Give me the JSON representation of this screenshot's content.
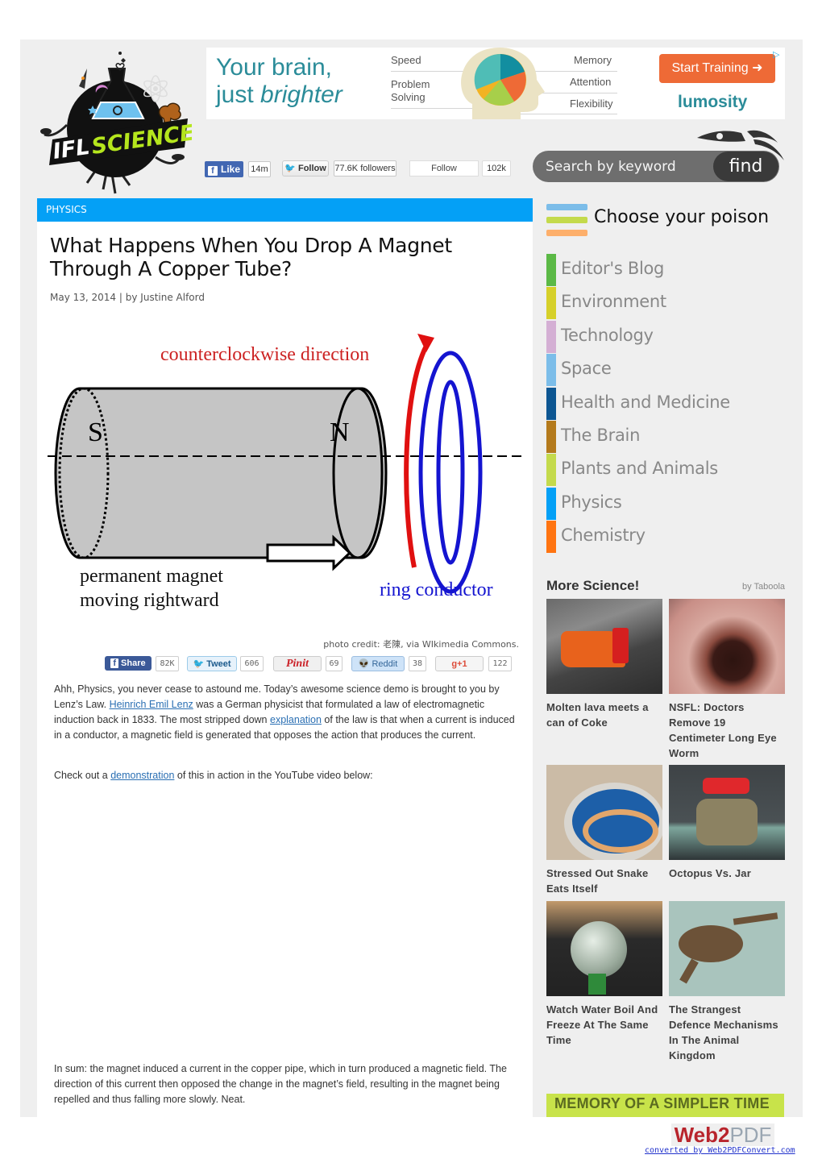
{
  "site": {
    "name": "IFLSCIENCE!"
  },
  "ad_banner": {
    "headline_line1": "Your brain,",
    "headline_line2_plain": "just ",
    "headline_line2_italic": "brighter",
    "labels_left": [
      "Speed",
      "Problem",
      "Solving"
    ],
    "labels_right": [
      "Memory",
      "Attention",
      "Flexibility"
    ],
    "cta": "Start Training ➜",
    "brand": "lumosity",
    "adchoices_icon": "adchoices-icon"
  },
  "social": {
    "facebook": {
      "label": "Like",
      "count": "14m"
    },
    "twitter": {
      "label": "Follow",
      "count": "77.6K followers"
    },
    "google": {
      "label": "Follow",
      "count": "102k"
    }
  },
  "search": {
    "placeholder": "Search by keyword",
    "button": "find"
  },
  "article": {
    "category": "PHYSICS",
    "title": "What Happens When You Drop A Magnet Through A Copper Tube?",
    "date": "May 13, 2014",
    "separator": "|",
    "byline": "by Justine Alford",
    "figure": {
      "labels": {
        "top": "counterclockwise direction",
        "south": "S",
        "north": "N",
        "magnet_line1": "permanent magnet",
        "magnet_line2": "moving rightward",
        "ring": "ring conductor"
      }
    },
    "photo_credit": "photo credit: 老陳, via WIkimedia Commons.",
    "share_buttons": [
      {
        "name": "facebook",
        "label": "Share",
        "count": "82K",
        "color": "#3b5998"
      },
      {
        "name": "twitter",
        "label": "Tweet",
        "count": "606",
        "color": "#1b95e0"
      },
      {
        "name": "pinterest",
        "label": "Pinit",
        "count": "69",
        "color": "#cb2027"
      },
      {
        "name": "reddit",
        "label": "Reddit",
        "count": "38",
        "color": "#cee3f8"
      },
      {
        "name": "googleplus",
        "label": "g+1",
        "count": "122",
        "color": "#dd4b39"
      }
    ],
    "paragraph1": {
      "t1": "Ahh, Physics, you never cease to astound me. Today’s awesome science demo is brought to you by Lenz’s Law. ",
      "link1": "Heinrich Emil Lenz",
      "t2": " was a German physicist that formulated a law of electromagnetic induction back in 1833. The most stripped down ",
      "link2": "explanation",
      "t3": " of the law is that when a current is induced in a conductor, a magnetic field is generated that opposes the action that produces the current."
    },
    "paragraph2": {
      "t1": "Check out a ",
      "link": "demonstration",
      "t2": " of this in action in the YouTube video below:"
    },
    "paragraph3": "In sum: the magnet induced a current in the copper pipe, which in turn produced a magnetic field. The direction of this current then opposed the change in the magnet’s field, resulting in the magnet being repelled and thus falling more slowly. Neat."
  },
  "sidebar": {
    "poison_title": "Choose your poison",
    "categories": [
      {
        "label": "Editor's Blog",
        "color": "#5bb946"
      },
      {
        "label": "Environment",
        "color": "#d6d02a"
      },
      {
        "label": "Technology",
        "color": "#d4afd4"
      },
      {
        "label": "Space",
        "color": "#7cbde9"
      },
      {
        "label": "Health and Medicine",
        "color": "#0d5692"
      },
      {
        "label": "The Brain",
        "color": "#b47a1c"
      },
      {
        "label": "Plants and Animals",
        "color": "#c4da4c"
      },
      {
        "label": "Physics",
        "color": "#04a0f6"
      },
      {
        "label": "Chemistry",
        "color": "#ff7411"
      }
    ],
    "more_title": "More Science!",
    "more_by": "by Taboola",
    "tiles": [
      {
        "caption": "Molten lava meets a can of Coke"
      },
      {
        "caption": "NSFL: Doctors Remove 19 Centimeter Long Eye Worm"
      },
      {
        "caption": "Stressed Out Snake Eats Itself"
      },
      {
        "caption": "Octopus Vs. Jar"
      },
      {
        "caption": "Watch Water Boil And Freeze At The Same Time"
      },
      {
        "caption": "The Strangest Defence Mechanisms In The Animal Kingdom"
      }
    ],
    "bottom_ad": "MEMORY OF A SIMPLER TIME"
  },
  "footer": {
    "logo_a": "Web2",
    "logo_b": "PDF",
    "link": "converted by Web2PDFConvert.com"
  }
}
